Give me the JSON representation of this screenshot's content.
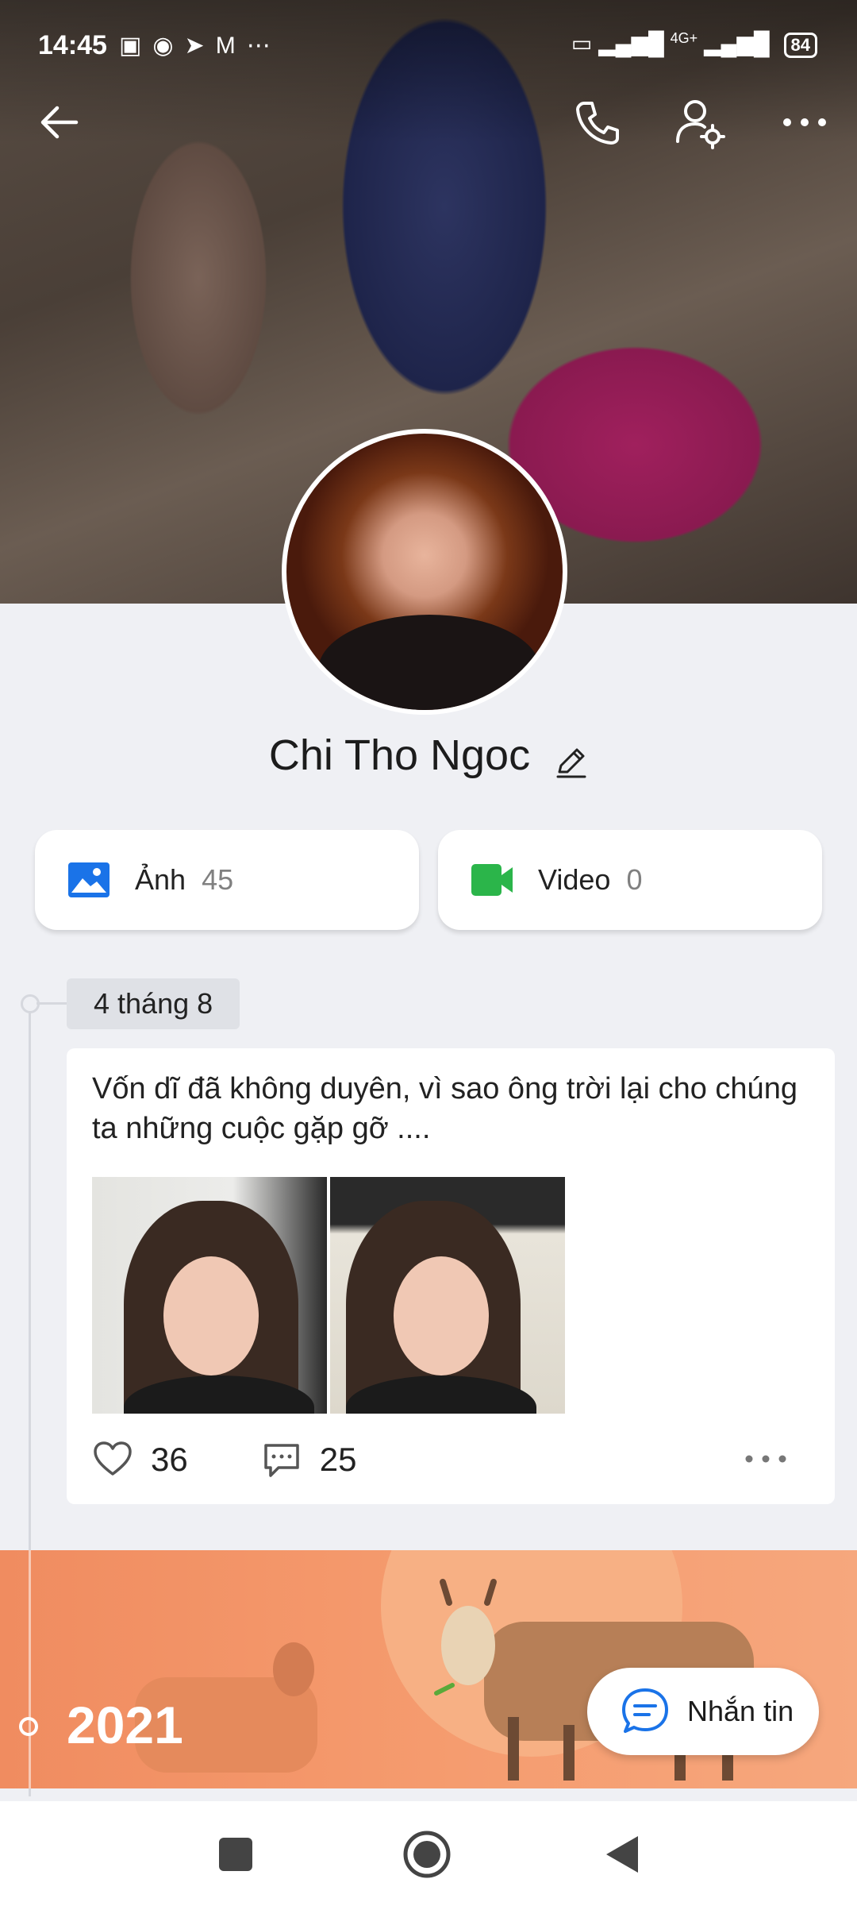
{
  "status_bar": {
    "time": "14:45",
    "left_icons": [
      "nfc-icon",
      "chat-icon",
      "telegram-icon",
      "gmail-icon",
      "more-icon"
    ],
    "network_label": "4G+",
    "battery": "84"
  },
  "header": {
    "back_icon": "arrow-left-icon",
    "call_icon": "phone-icon",
    "user_settings_icon": "user-gear-icon",
    "more_icon": "more-dots-icon"
  },
  "profile": {
    "name": "Chi Tho Ngoc"
  },
  "media": {
    "photos": {
      "label": "Ảnh",
      "count": "45",
      "icon": "image-icon",
      "color": "#1a73e8"
    },
    "videos": {
      "label": "Video",
      "count": "0",
      "icon": "video-icon",
      "color": "#2bb54a"
    }
  },
  "timeline": {
    "date": "4 tháng 8",
    "post": {
      "text": "Vốn dĩ đã không duyên, vì sao ông trời lại cho chúng ta những cuộc gặp gỡ ....",
      "likes": "36",
      "comments": "25"
    },
    "year": "2021"
  },
  "message_button": {
    "label": "Nhắn tin"
  },
  "colors": {
    "accent": "#1a73e8",
    "banner": "#f59b6e",
    "background": "#eff0f4"
  }
}
